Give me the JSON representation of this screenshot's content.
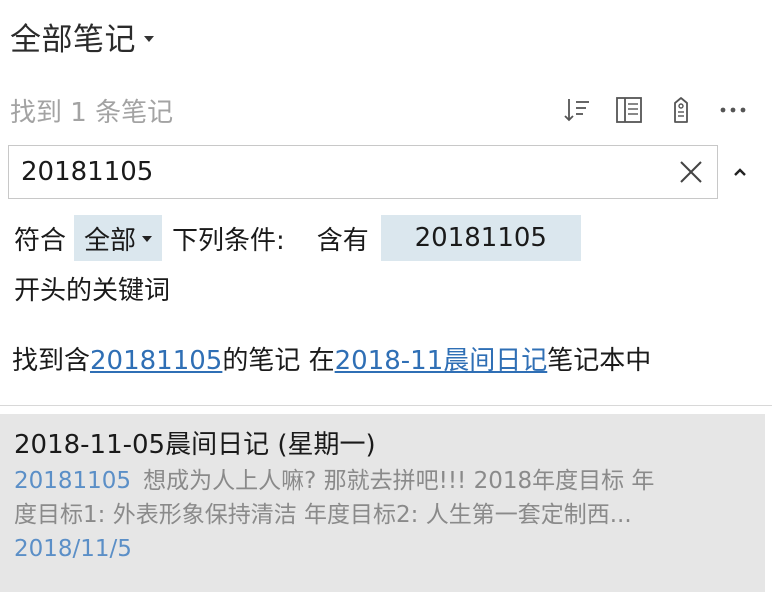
{
  "header": {
    "title": "全部笔记"
  },
  "results": {
    "count_text": "找到 1 条笔记"
  },
  "toolbar": {
    "icons": [
      "sort-icon",
      "view-icon",
      "tag-icon",
      "more-icon"
    ]
  },
  "search": {
    "value": "20181105",
    "placeholder": ""
  },
  "condition": {
    "prefix": "符合",
    "match": "全部",
    "middle": "下列条件:",
    "contains": "含有",
    "keyword": "20181105",
    "suffix": "开头的关键词"
  },
  "found": {
    "prefix": "找到含",
    "keyword": "20181105",
    "middle": "的笔记 在",
    "notebook": "2018-11晨间日记",
    "suffix": "笔记本中"
  },
  "notes": [
    {
      "title": "2018-11-05晨间日记 (星期一)",
      "snippet_highlight": "20181105",
      "snippet_line1": "想成为人上人嘛? 那就去拼吧!!! 2018年度目标 年",
      "snippet_line2": "度目标1: 外表形象保持清洁 年度目标2: 人生第一套定制西...",
      "date": "2018/11/5"
    }
  ],
  "colors": {
    "link": "#2f6fb5",
    "chip_bg": "#dbe7ee",
    "card_bg": "#e6e6e6",
    "muted": "#a3a3a3"
  }
}
